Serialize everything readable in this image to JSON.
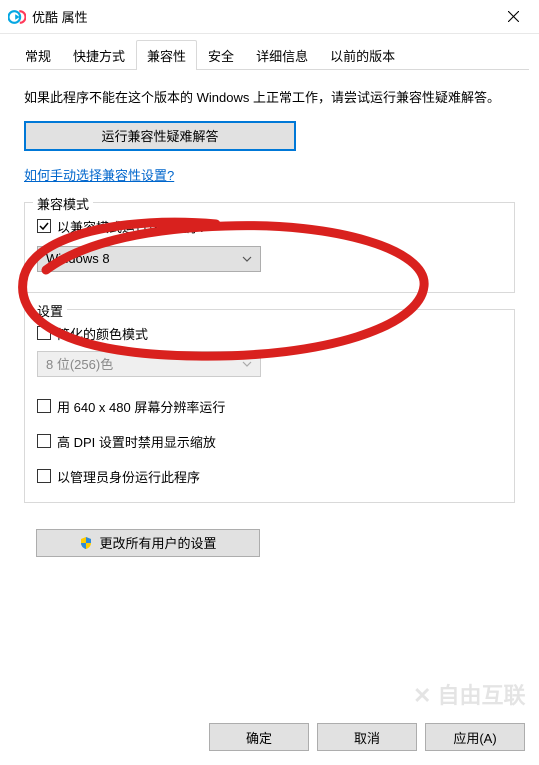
{
  "window": {
    "title": "优酷 属性"
  },
  "tabs": {
    "items": [
      "常规",
      "快捷方式",
      "兼容性",
      "安全",
      "详细信息",
      "以前的版本"
    ],
    "active_index": 2
  },
  "intro_text": "如果此程序不能在这个版本的 Windows 上正常工作，请尝试运行兼容性疑难解答。",
  "troubleshoot_button": "运行兼容性疑难解答",
  "manual_link": "如何手动选择兼容性设置?",
  "compat_mode": {
    "group_title": "兼容模式",
    "checkbox_label": "以兼容模式运行这个程序:",
    "checked": true,
    "selected_os": "Windows 8"
  },
  "settings": {
    "group_title": "设置",
    "reduced_color_label": "简化的颜色模式",
    "reduced_color_checked": false,
    "color_mode_value": "8 位(256)色",
    "resolution_label": "用 640 x 480 屏幕分辨率运行",
    "resolution_checked": false,
    "dpi_label": "高 DPI 设置时禁用显示缩放",
    "dpi_checked": false,
    "admin_label": "以管理员身份运行此程序",
    "admin_checked": false
  },
  "all_users_button": "更改所有用户的设置",
  "footer": {
    "ok": "确定",
    "cancel": "取消",
    "apply": "应用(A)"
  },
  "icons": {
    "app": "youku-icon",
    "close": "close-icon",
    "shield": "shield-icon",
    "chevron": "chevron-down-icon"
  }
}
